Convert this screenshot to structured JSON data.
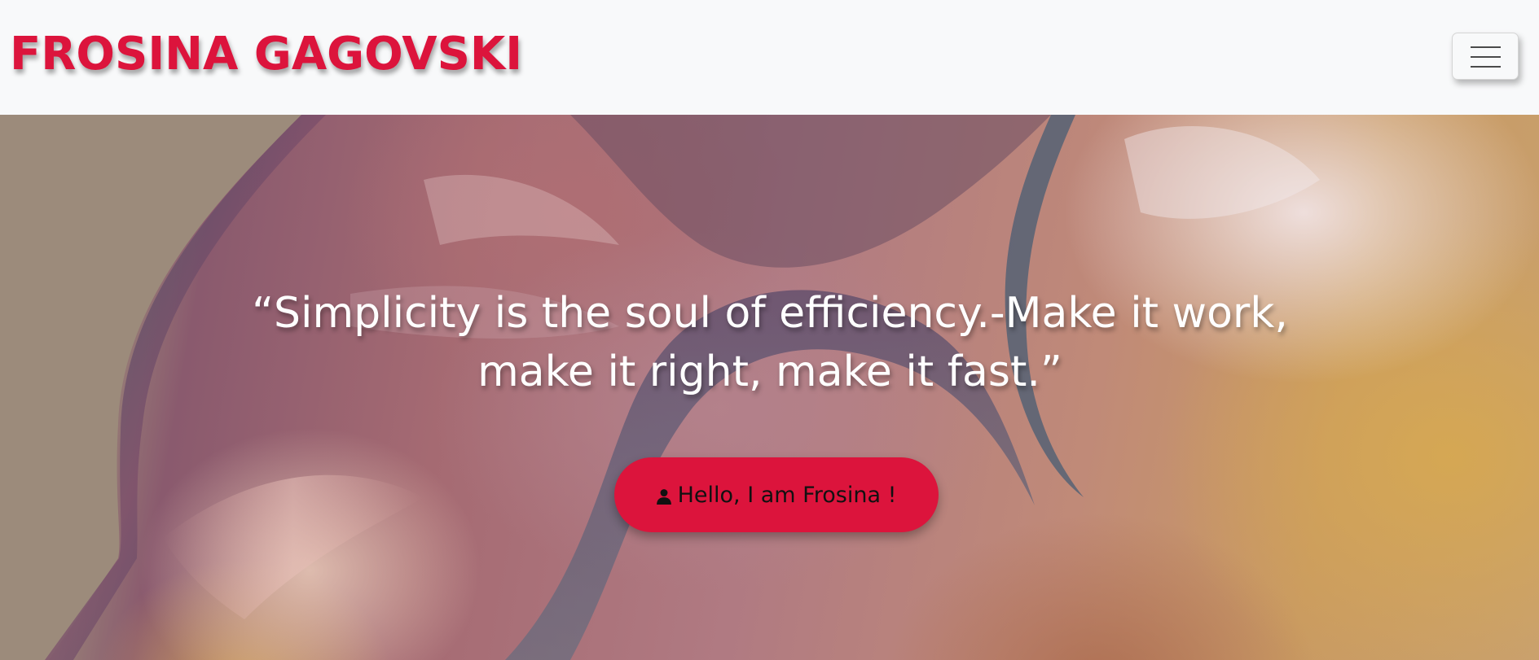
{
  "navbar": {
    "brand": "FROSINA GAGOVSKI",
    "toggler_icon": "hamburger-menu-icon"
  },
  "hero": {
    "quote": "“Simplicity is the soul of efficiency.-Make it work, make it right, make it fast.”",
    "cta_label": "Hello, I am Frosina !",
    "cta_icon": "user-icon"
  },
  "colors": {
    "brand": "#dc143c",
    "navbar_bg": "#f8f9fa",
    "quote_text": "#ffffff",
    "cta_bg": "#dc143c"
  }
}
